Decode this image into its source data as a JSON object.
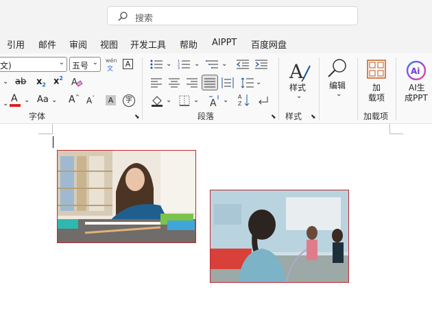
{
  "search": {
    "placeholder": "搜索"
  },
  "menu": [
    "引用",
    "邮件",
    "审阅",
    "视图",
    "开发工具",
    "帮助",
    "AIPPT",
    "百度网盘"
  ],
  "font": {
    "name": "文)",
    "size": "五号",
    "pinyin_top": "wén",
    "pinyin_bottom": "文",
    "group_label": "字体"
  },
  "paragraph": {
    "group_label": "段落"
  },
  "styles": {
    "button_label": "样式",
    "group_label": "样式"
  },
  "editing": {
    "button_label": "编辑"
  },
  "addins": {
    "button_line1": "加",
    "button_line2": "载项",
    "group_label": "加载项"
  },
  "ai": {
    "line1": "AI生",
    "line2": "成PPT"
  },
  "glyphs": {
    "strike": "ab",
    "aa": "Aa",
    "grow": "A",
    "shrink": "A",
    "shade": "A",
    "box": "A",
    "circle": "字",
    "font_color": "A",
    "sub": "x",
    "sup": "x"
  },
  "images": [
    {
      "name": "girl-drawing-at-desk-photo"
    },
    {
      "name": "girl-in-classroom-photo"
    }
  ]
}
